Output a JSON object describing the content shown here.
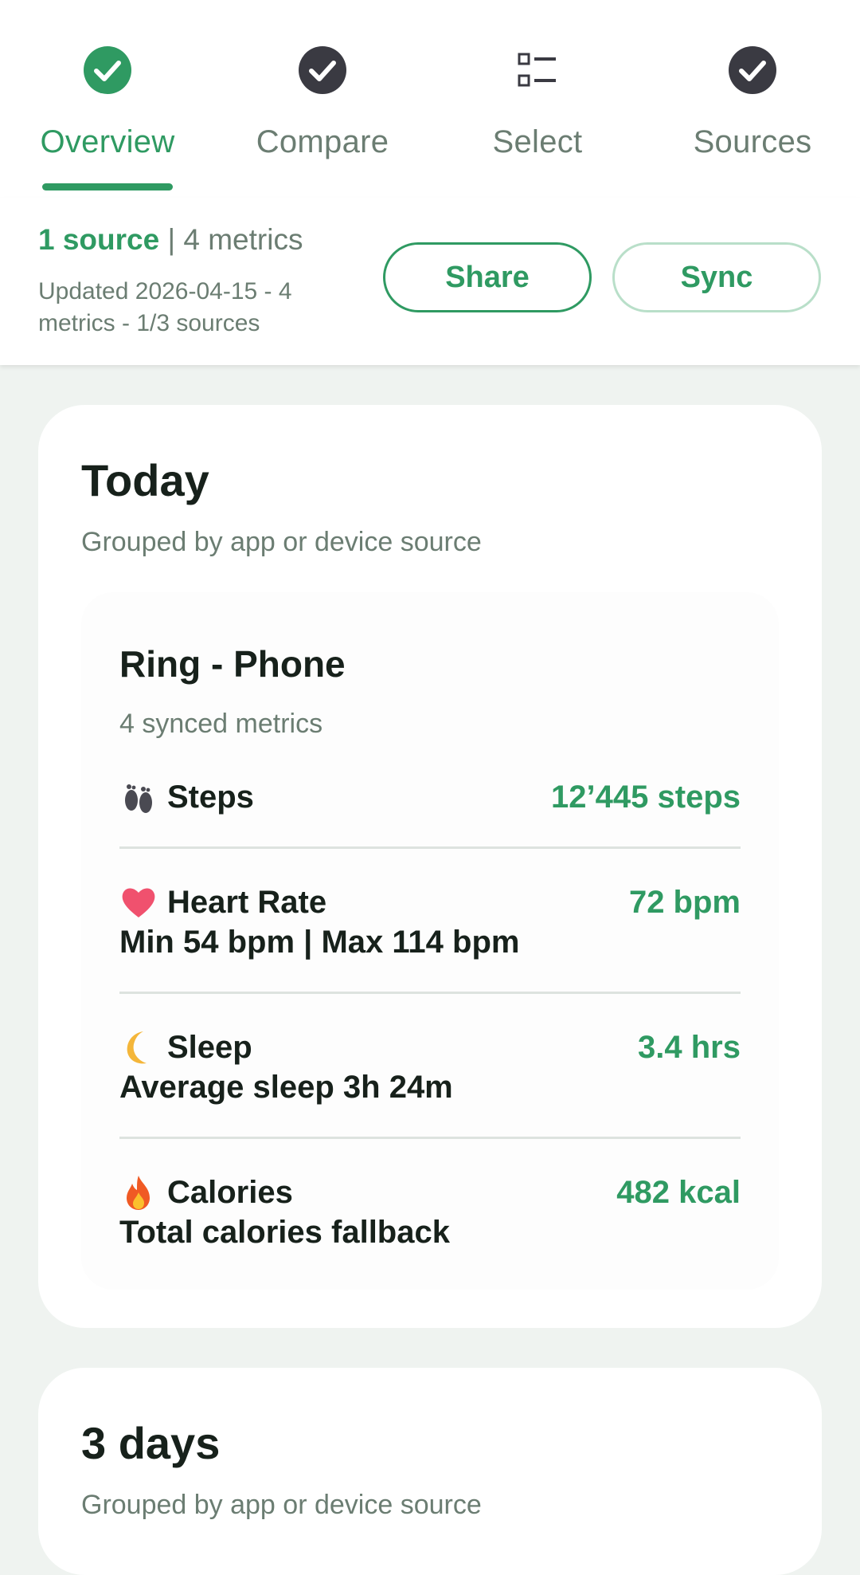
{
  "tabs": [
    {
      "label": "Overview",
      "icon": "check-circle-icon",
      "active": true
    },
    {
      "label": "Compare",
      "icon": "check-circle-icon",
      "active": false
    },
    {
      "label": "Select",
      "icon": "list-checkbox-icon",
      "active": false
    },
    {
      "label": "Sources",
      "icon": "check-circle-icon",
      "active": false
    }
  ],
  "status": {
    "source_count": "1 source",
    "separator": " | ",
    "metric_count": "4 metrics",
    "updated": "Updated 2026-04-15 - 4 metrics - 1/3 sources",
    "share_label": "Share",
    "sync_label": "Sync"
  },
  "today": {
    "title": "Today",
    "subtitle": "Grouped by app or device source",
    "source": {
      "name": "Ring - Phone",
      "subtitle": "4 synced metrics",
      "metrics": [
        {
          "emoji": "👣",
          "icon": "footprints-icon",
          "name": "Steps",
          "detail": "",
          "value": "12’445 steps"
        },
        {
          "emoji": "❤️",
          "icon": "heart-icon",
          "name": "Heart Rate",
          "detail": "Min 54 bpm | Max 114 bpm",
          "value": "72 bpm"
        },
        {
          "emoji": "🌙",
          "icon": "moon-icon",
          "name": "Sleep",
          "detail": "Average sleep 3h 24m",
          "value": "3.4 hrs"
        },
        {
          "emoji": "🔥",
          "icon": "fire-icon",
          "name": "Calories",
          "detail": "Total calories fallback",
          "value": "482 kcal"
        }
      ]
    }
  },
  "three_days": {
    "title": "3 days",
    "subtitle": "Grouped by app or device source"
  },
  "colors": {
    "accent": "#2f9a62",
    "muted_text": "#6b7d72",
    "dark_text": "#17211b",
    "page_bg": "#eff3f0",
    "icon_dark": "#3a3a42"
  }
}
